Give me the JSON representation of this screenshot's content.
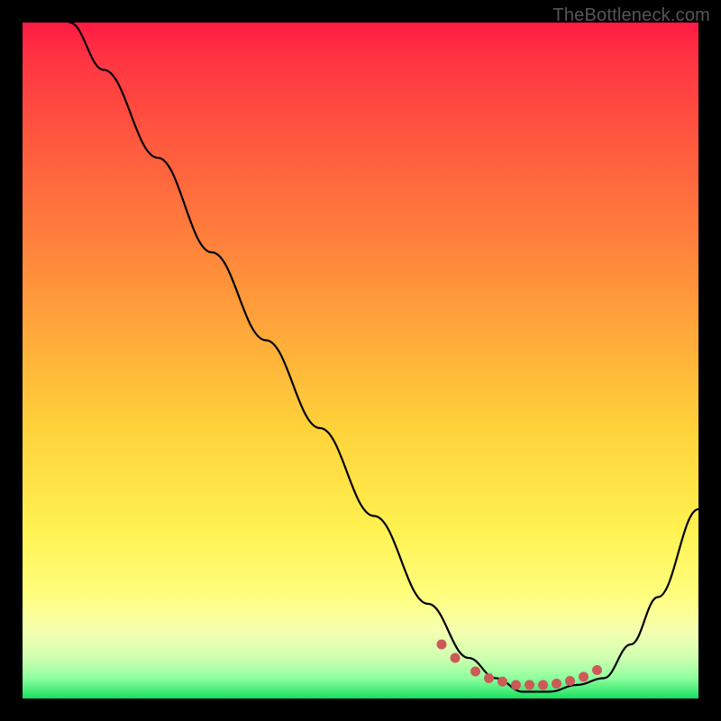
{
  "watermark": "TheBottleneck.com",
  "chart_data": {
    "type": "line",
    "title": "",
    "xlabel": "",
    "ylabel": "",
    "xlim": [
      0,
      100
    ],
    "ylim": [
      0,
      100
    ],
    "series": [
      {
        "name": "bottleneck-curve",
        "x": [
          7,
          12,
          20,
          28,
          36,
          44,
          52,
          60,
          66,
          70,
          74,
          78,
          82,
          86,
          90,
          94,
          100
        ],
        "y": [
          100,
          93,
          80,
          66,
          53,
          40,
          27,
          14,
          6,
          3,
          1,
          1,
          2,
          3,
          8,
          15,
          28
        ]
      }
    ],
    "highlight_points": {
      "name": "trough-markers",
      "color": "#cc5a58",
      "x": [
        62,
        64,
        67,
        69,
        71,
        73,
        75,
        77,
        79,
        81,
        83,
        85
      ],
      "y": [
        8,
        6,
        4,
        3,
        2.5,
        2,
        2,
        2,
        2.2,
        2.6,
        3.2,
        4.2
      ]
    },
    "gradient_stops": [
      {
        "pos": 0,
        "color": "#ff1a44"
      },
      {
        "pos": 18,
        "color": "#ff5a3f"
      },
      {
        "pos": 45,
        "color": "#ffa63a"
      },
      {
        "pos": 75,
        "color": "#fff250"
      },
      {
        "pos": 90,
        "color": "#f5ffb0"
      },
      {
        "pos": 100,
        "color": "#18e060"
      }
    ]
  }
}
